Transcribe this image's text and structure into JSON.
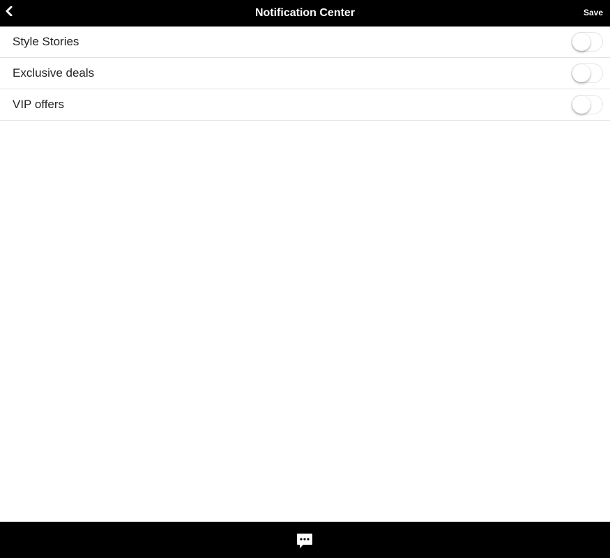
{
  "header": {
    "title": "Notification Center",
    "back_icon": "chevron-left-icon",
    "save_label": "Save"
  },
  "settings": [
    {
      "label": "Style Stories",
      "enabled": false
    },
    {
      "label": "Exclusive deals",
      "enabled": false
    },
    {
      "label": "VIP offers",
      "enabled": false
    }
  ],
  "footer": {
    "chat_icon": "chat-bubble-icon"
  },
  "colors": {
    "header_bg": "#000000",
    "footer_bg": "#000000",
    "divider": "#e3e3e3",
    "text": "#222222"
  }
}
